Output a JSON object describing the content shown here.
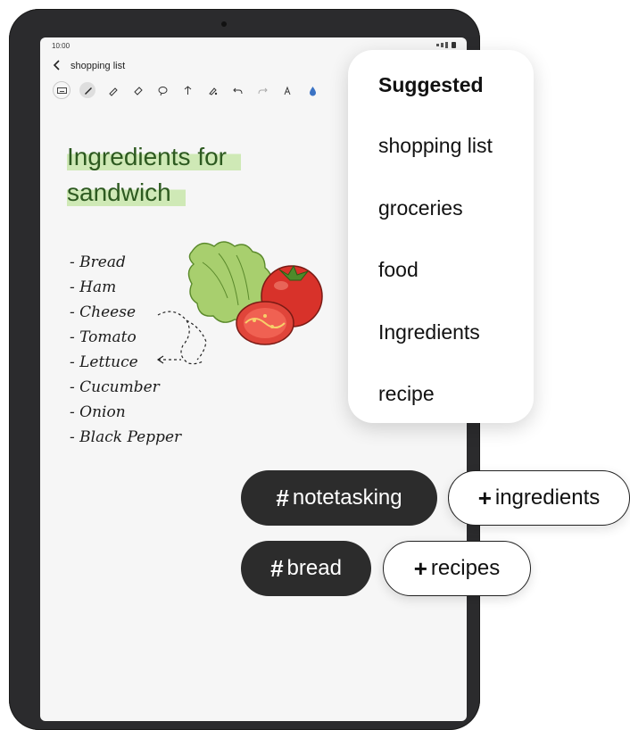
{
  "status": {
    "time": "10:00"
  },
  "note": {
    "title": "shopping list"
  },
  "toolbar": {
    "tools": [
      "keyboard-icon",
      "pen-icon",
      "highlighter-icon",
      "eraser-icon",
      "lasso-icon",
      "text-to-shape-icon",
      "pen-settings-icon",
      "undo-icon",
      "redo-icon",
      "text-format-icon",
      "color-icon"
    ]
  },
  "content": {
    "heading_line1": "Ingredients for",
    "heading_line2": "sandwich",
    "list": [
      "- Bread",
      "- Ham",
      "- Cheese",
      "- Tomato",
      "- Lettuce",
      "- Cucumber",
      "- Onion",
      "- Black Pepper"
    ],
    "highlight_color": "#cfe9b6"
  },
  "suggested": {
    "title": "Suggested",
    "items": [
      "shopping list",
      "groceries",
      "food",
      "Ingredients",
      "recipe"
    ]
  },
  "tags": {
    "applied": [
      {
        "symbol": "#",
        "label": "notetasking"
      },
      {
        "symbol": "#",
        "label": "bread"
      }
    ],
    "suggested": [
      {
        "symbol": "+",
        "label": "ingredients"
      },
      {
        "symbol": "+",
        "label": "recipes"
      }
    ]
  }
}
